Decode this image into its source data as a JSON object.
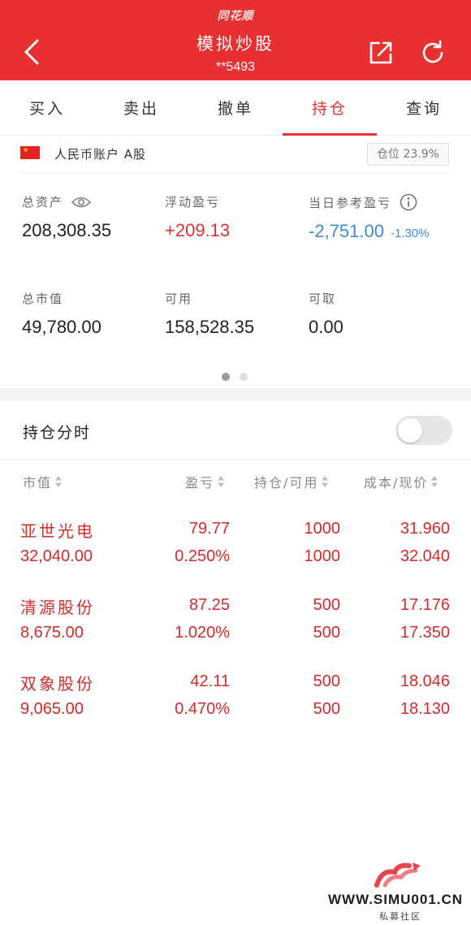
{
  "header": {
    "brand": "同花顺",
    "title": "模拟炒股",
    "account_no": "**5493",
    "back_icon": "chevron-left-icon",
    "share_icon": "share-icon",
    "refresh_icon": "refresh-icon",
    "bg_color": "#e93030"
  },
  "tabs": [
    {
      "label": "买入"
    },
    {
      "label": "卖出"
    },
    {
      "label": "撤单"
    },
    {
      "label": "持仓",
      "active": true
    },
    {
      "label": "查询"
    }
  ],
  "account": {
    "label": "人民币账户 A股",
    "position_label": "仓位 23.9%"
  },
  "assets": {
    "total_assets": {
      "label": "总资产",
      "value": "208,308.35"
    },
    "floating_pl": {
      "label": "浮动盈亏",
      "value": "+209.13"
    },
    "daily_pl": {
      "label": "当日参考盈亏",
      "value": "-2,751.00",
      "pct": "-1.30%"
    },
    "market_value": {
      "label": "总市值",
      "value": "49,780.00"
    },
    "available": {
      "label": "可用",
      "value": "158,528.35"
    },
    "withdrawable": {
      "label": "可取",
      "value": "0.00"
    }
  },
  "pager": {
    "count": 2,
    "active": 0
  },
  "timeshare": {
    "label": "持仓分时",
    "enabled": false
  },
  "table": {
    "headers": {
      "market_value": "市值",
      "pl": "盈亏",
      "holding": "持仓/可用",
      "cost_price": "成本/现价"
    },
    "rows": [
      {
        "name": "亚世光电",
        "market_value": "32,040.00",
        "pl": "79.77",
        "pl_pct": "0.250%",
        "holding": "1000",
        "available": "1000",
        "cost": "31.960",
        "price": "32.040"
      },
      {
        "name": "清源股份",
        "market_value": "8,675.00",
        "pl": "87.25",
        "pl_pct": "1.020%",
        "holding": "500",
        "available": "500",
        "cost": "17.176",
        "price": "17.350"
      },
      {
        "name": "双象股份",
        "market_value": "9,065.00",
        "pl": "42.11",
        "pl_pct": "0.470%",
        "holding": "500",
        "available": "500",
        "cost": "18.046",
        "price": "18.130"
      }
    ]
  },
  "watermark": {
    "text": "WWW.SIMU001.CN",
    "sub": "私募社区"
  }
}
